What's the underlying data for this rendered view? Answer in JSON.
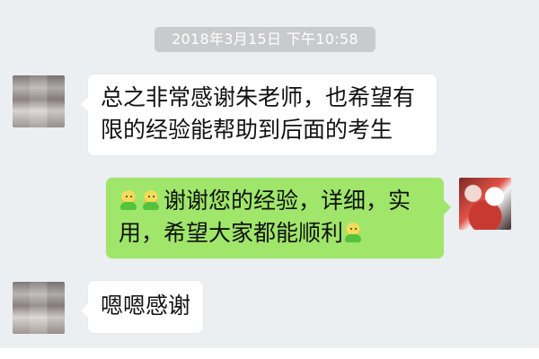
{
  "chat": {
    "timestamp": "2018年3月15日 下午10:58",
    "messages": [
      {
        "sender": "other",
        "lines": [
          "总之非常感谢朱老师，也希望有",
          "限的经验能帮助到后面的考生"
        ]
      },
      {
        "sender": "self",
        "line1_text": "谢谢您的经验，详细，实",
        "line2_text": "用，希望大家都能顺利",
        "emoji": "smiling-sprout-emoji"
      },
      {
        "sender": "other",
        "lines": [
          "嗯嗯感谢"
        ]
      }
    ]
  },
  "colors": {
    "background": "#eceff1",
    "incoming_bubble": "#ffffff",
    "outgoing_bubble": "#9fe66b",
    "timestamp_badge": "#c8cbcd"
  }
}
